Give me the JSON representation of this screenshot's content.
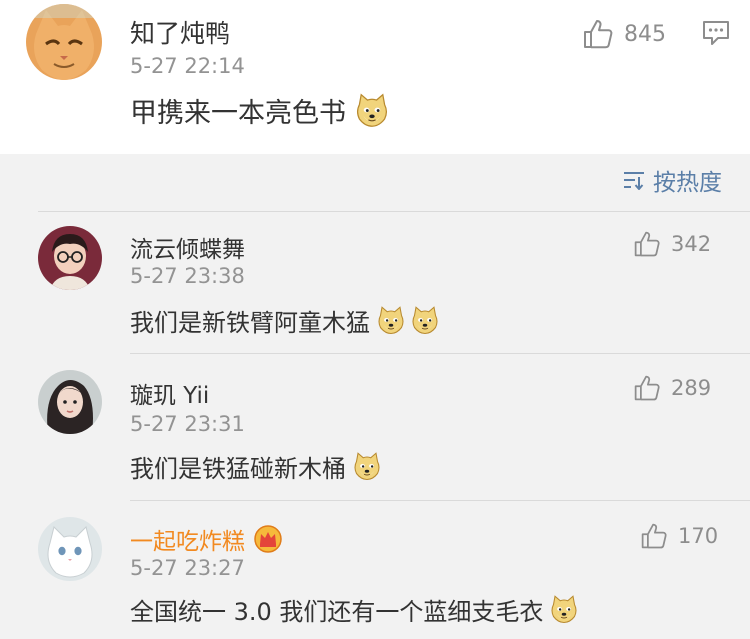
{
  "post": {
    "username": "知了炖鸭",
    "time": "5-27 22:14",
    "text": "甲携来一本亮色书",
    "likes": "845"
  },
  "sort": {
    "label": "按热度"
  },
  "comments": [
    {
      "username": "流云倾蝶舞",
      "time": "5-27 23:38",
      "text": "我们是新铁臂阿童木猛",
      "likes": "342"
    },
    {
      "username": "璇玑 Yii",
      "time": "5-27 23:31",
      "text": "我们是铁猛碰新木桶",
      "likes": "289"
    },
    {
      "username": "一起吃炸糕",
      "time": "5-27 23:27",
      "text": "全国统一 3.0 我们还有一个蓝细支毛衣",
      "likes": "170"
    }
  ],
  "colors": {
    "username": "#333333",
    "vip_username": "#f28a21",
    "timestamp": "#939393",
    "sort_link": "#5b7fa8",
    "background": "#f2f2f2"
  },
  "icons": [
    "thumb-up-icon",
    "comment-icon",
    "sort-icon",
    "doge-emoji",
    "vip-crown-icon"
  ]
}
